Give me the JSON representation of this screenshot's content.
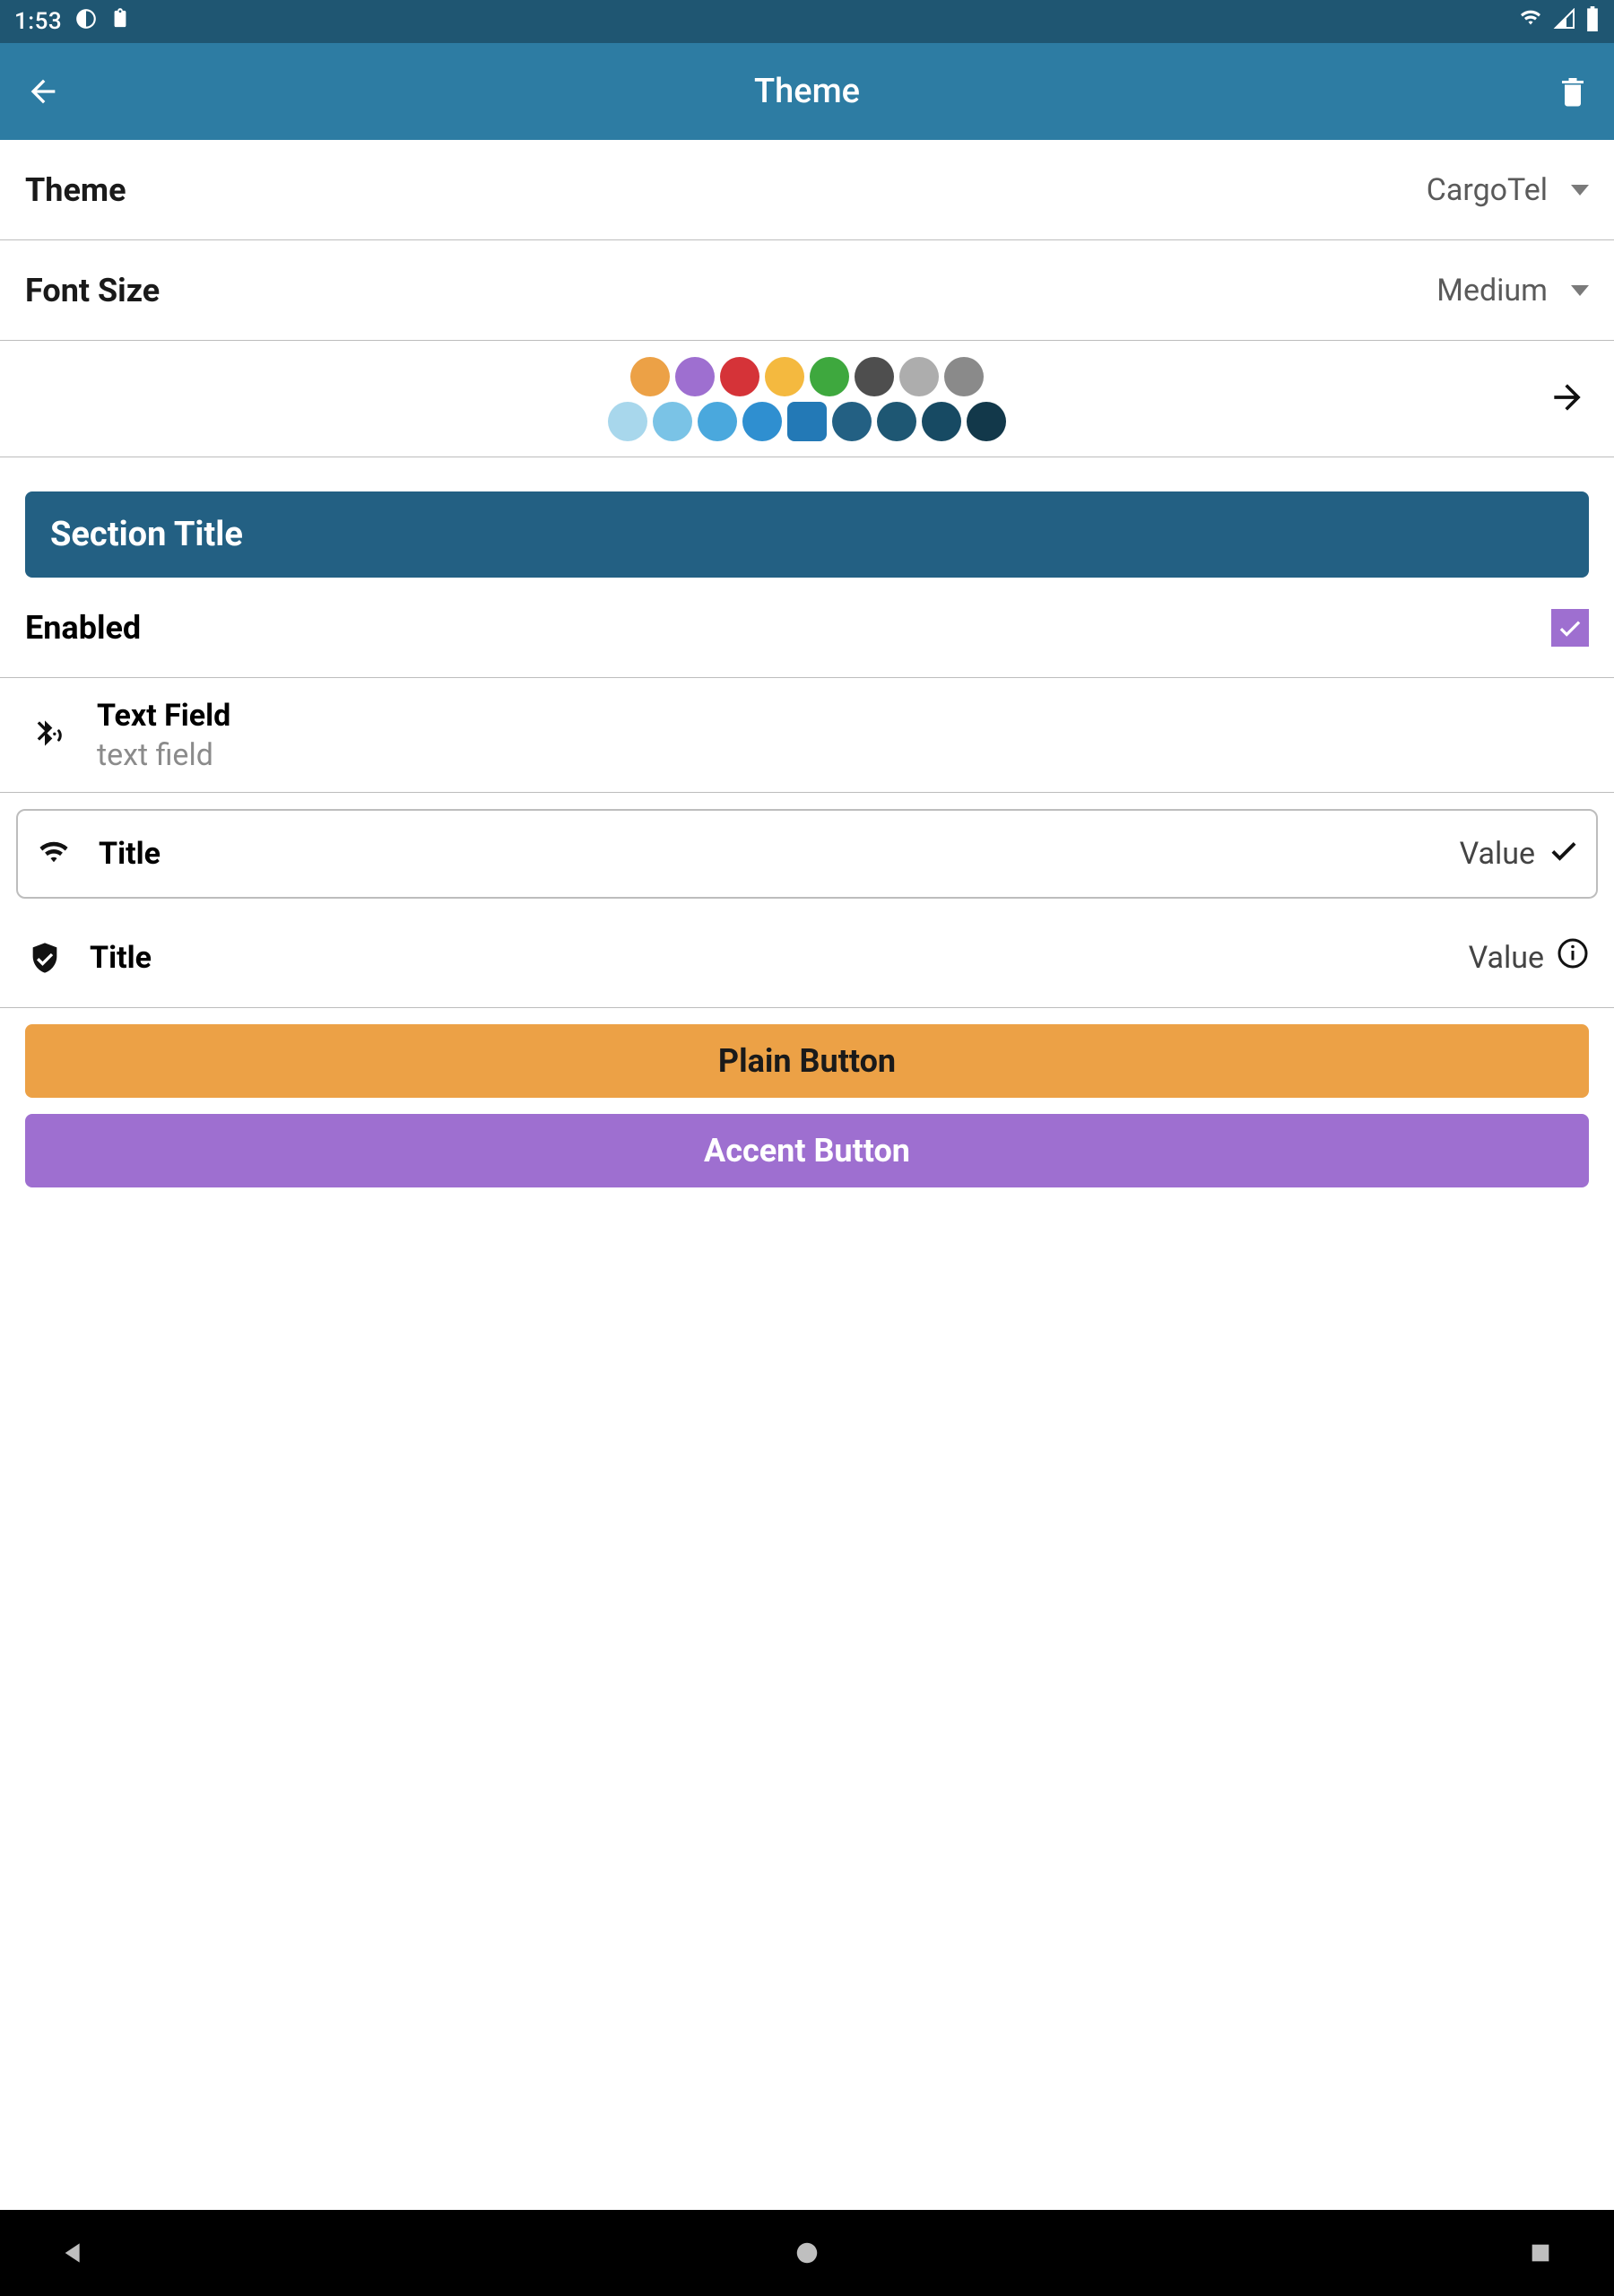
{
  "status": {
    "time": "1:53"
  },
  "appbar": {
    "title": "Theme"
  },
  "theme_row": {
    "label": "Theme",
    "value": "CargoTel"
  },
  "font_row": {
    "label": "Font Size",
    "value": "Medium"
  },
  "colors": {
    "row1": [
      "#eca146",
      "#9e6fd0",
      "#d53338",
      "#f4b93f",
      "#3ea83e",
      "#4e4e4e",
      "#adadad",
      "#8a8a8a"
    ],
    "row2": [
      "#a8d7ec",
      "#7ac3e6",
      "#4aa8dd",
      "#2f8fd0",
      "#2379b6",
      "#236083",
      "#1e5773",
      "#174a63",
      "#12384a"
    ],
    "selected_index_row2": 4
  },
  "section": {
    "title": "Section Title"
  },
  "enabled": {
    "label": "Enabled",
    "checked": true
  },
  "textfield": {
    "label": "Text Field",
    "hint": "text field"
  },
  "item1": {
    "title": "Title",
    "value": "Value"
  },
  "item2": {
    "title": "Title",
    "value": "Value"
  },
  "buttons": {
    "plain": "Plain Button",
    "accent": "Accent Button"
  }
}
